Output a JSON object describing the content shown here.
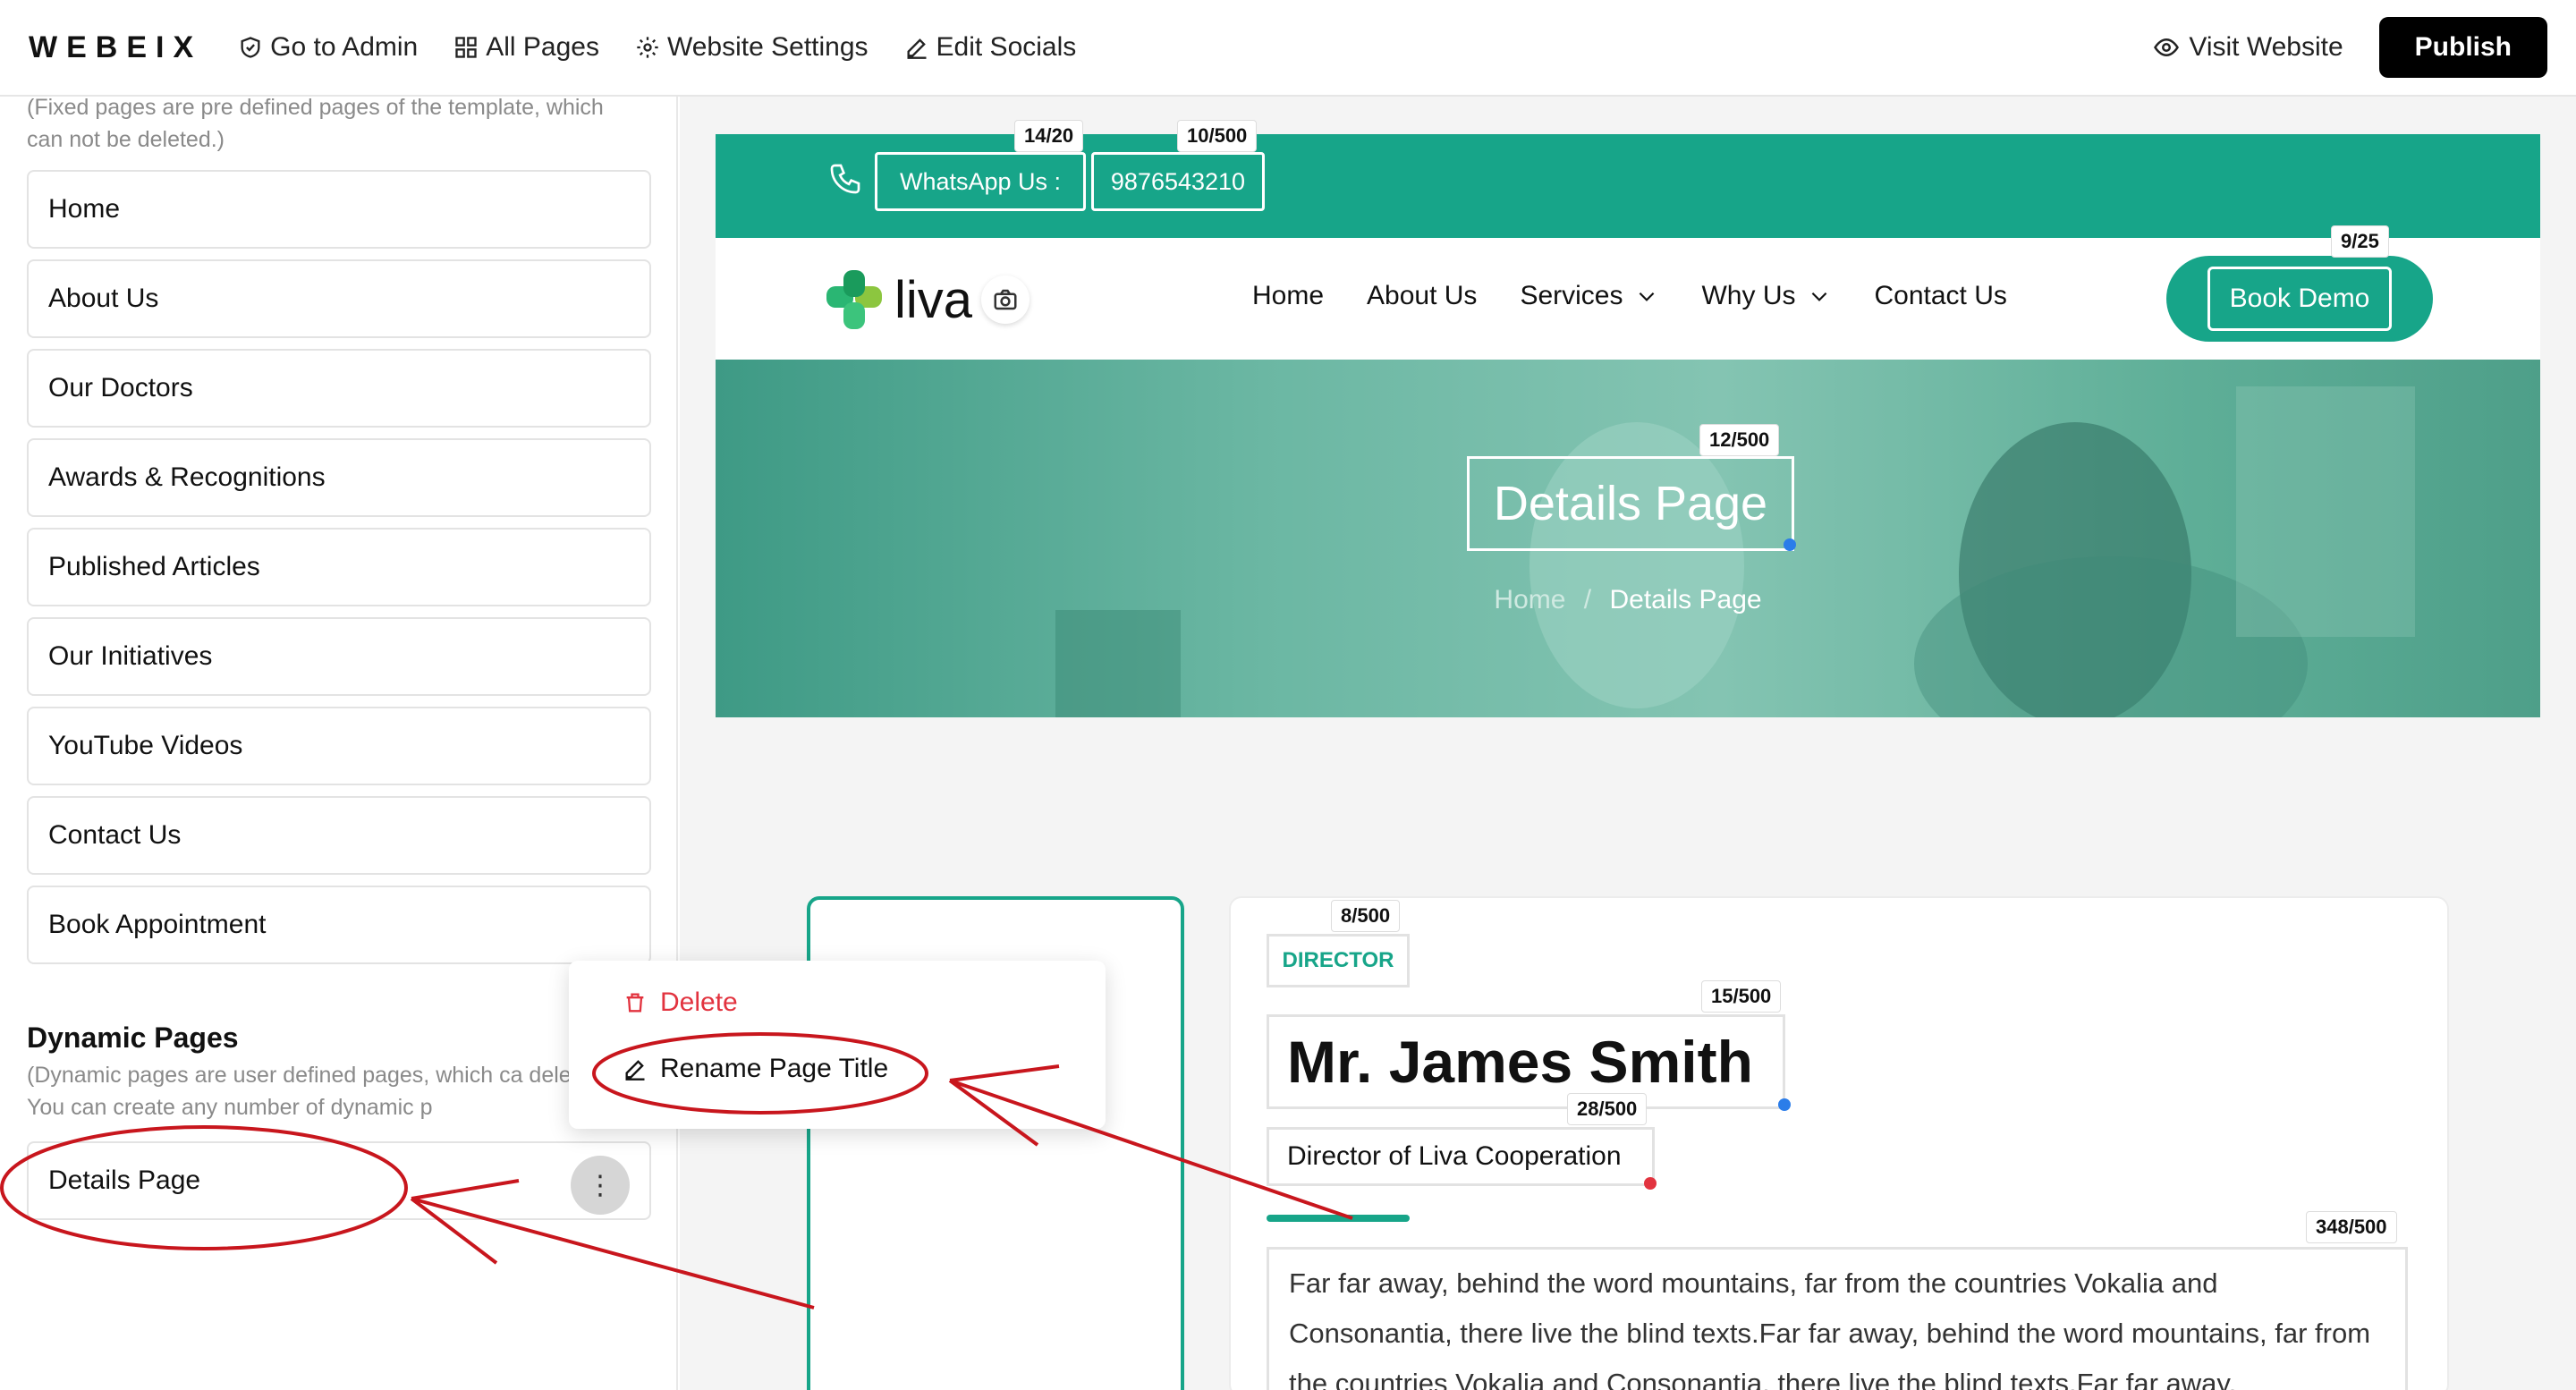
{
  "topbar": {
    "logo": "WEBEIX",
    "nav": [
      {
        "label": "Go to Admin",
        "icon": "shield-check-icon"
      },
      {
        "label": "All Pages",
        "icon": "grid-icon"
      },
      {
        "label": "Website Settings",
        "icon": "gear-icon"
      },
      {
        "label": "Edit Socials",
        "icon": "pencil-icon"
      }
    ],
    "visit_label": "Visit Website",
    "publish_label": "Publish"
  },
  "sidebar": {
    "fixed_note": "(Fixed pages are pre defined pages of the template, which can not be deleted.)",
    "fixed_pages": [
      "Home",
      "About Us",
      "Our Doctors",
      "Awards & Recognitions",
      "Published Articles",
      "Our Initiatives",
      "YouTube Videos",
      "Contact Us",
      "Book Appointment"
    ],
    "dynamic_title": "Dynamic Pages",
    "dynamic_note": "(Dynamic pages are user defined pages, which ca deleted. You can create any number of dynamic p",
    "dynamic_pages": [
      "Details Page"
    ]
  },
  "context_menu": {
    "delete_label": "Delete",
    "rename_label": "Rename Page Title"
  },
  "preview": {
    "topbar": {
      "whatsapp_label": "WhatsApp Us :",
      "whatsapp_counter": "14/20",
      "phone": "9876543210",
      "phone_counter": "10/500"
    },
    "nav": {
      "brand": "liva",
      "menu": [
        "Home",
        "About Us",
        "Services",
        "Why Us",
        "Contact Us"
      ],
      "book_label": "Book Demo",
      "book_counter": "9/25"
    },
    "hero": {
      "title": "Details Page",
      "title_counter": "12/500",
      "crumb_home": "Home",
      "crumb_sep": "/",
      "crumb_current": "Details Page"
    },
    "profile": {
      "tag": "DIRECTOR",
      "tag_counter": "8/500",
      "name": "Mr. James Smith",
      "name_counter": "15/500",
      "role": "Director of Liva Cooperation",
      "role_counter": "28/500",
      "bio": "Far far away, behind the word mountains, far from the countries Vokalia and Consonantia, there live the blind texts.Far far away, behind the word mountains, far from the countries Vokalia and Consonantia, there live the blind texts.Far far away,",
      "bio_counter": "348/500"
    }
  },
  "colors": {
    "brand_green": "#17a589",
    "annotation_red": "#c8161d",
    "delete_red": "#e2333f"
  }
}
